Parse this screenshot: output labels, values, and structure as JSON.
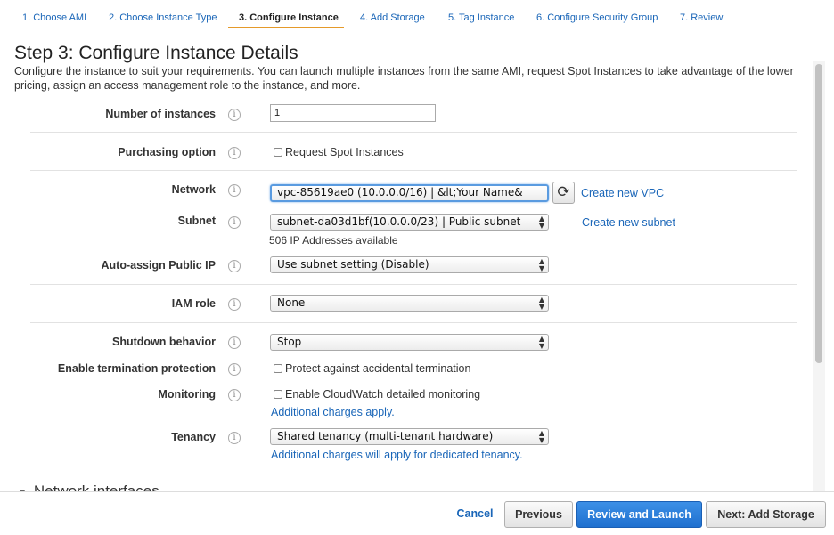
{
  "wizard": {
    "tabs": [
      {
        "label": "1. Choose AMI"
      },
      {
        "label": "2. Choose Instance Type"
      },
      {
        "label": "3. Configure Instance"
      },
      {
        "label": "4. Add Storage"
      },
      {
        "label": "5. Tag Instance"
      },
      {
        "label": "6. Configure Security Group"
      },
      {
        "label": "7. Review"
      }
    ],
    "active_tab": "3. Configure Instance"
  },
  "page": {
    "title": "Step 3: Configure Instance Details",
    "description": "Configure the instance to suit your requirements. You can launch multiple instances from the same AMI, request Spot Instances to take advantage of the lower pricing, assign an access management role to the instance, and more."
  },
  "form": {
    "number_of_instances": {
      "label": "Number of instances",
      "value": "1"
    },
    "purchasing_option": {
      "label": "Purchasing option",
      "checkbox_label": "Request Spot Instances",
      "checked": false
    },
    "network": {
      "label": "Network",
      "value": "vpc-85619ae0 (10.0.0.0/16) | &lt;Your Name&",
      "create_link": "Create new VPC"
    },
    "subnet": {
      "label": "Subnet",
      "value": "subnet-da03d1bf(10.0.0.0/23) | Public subnet",
      "create_link": "Create new subnet",
      "note": "506 IP Addresses available"
    },
    "auto_assign_ip": {
      "label": "Auto-assign Public IP",
      "value": "Use subnet setting (Disable)"
    },
    "iam_role": {
      "label": "IAM role",
      "value": "None"
    },
    "shutdown_behavior": {
      "label": "Shutdown behavior",
      "value": "Stop"
    },
    "termination_protection": {
      "label": "Enable termination protection",
      "checkbox_label": "Protect against accidental termination",
      "checked": false
    },
    "monitoring": {
      "label": "Monitoring",
      "checkbox_label": "Enable CloudWatch detailed monitoring",
      "checked": false,
      "link": "Additional charges apply."
    },
    "tenancy": {
      "label": "Tenancy",
      "value": "Shared tenancy (multi-tenant hardware)",
      "link": "Additional charges will apply for dedicated tenancy."
    }
  },
  "sections": {
    "network_interfaces": "Network interfaces"
  },
  "icons": {
    "info": "i",
    "refresh": "⟳",
    "select_arrows": "▲▼",
    "collapse_arrow": "▼"
  },
  "footer": {
    "cancel": "Cancel",
    "previous": "Previous",
    "review_launch": "Review and Launch",
    "next": "Next: Add Storage"
  },
  "colors": {
    "link": "#1a66b8",
    "primary_button": "#2a7ad8",
    "active_tab_underline": "#e59a2a",
    "focus_ring": "#5a9be0"
  }
}
